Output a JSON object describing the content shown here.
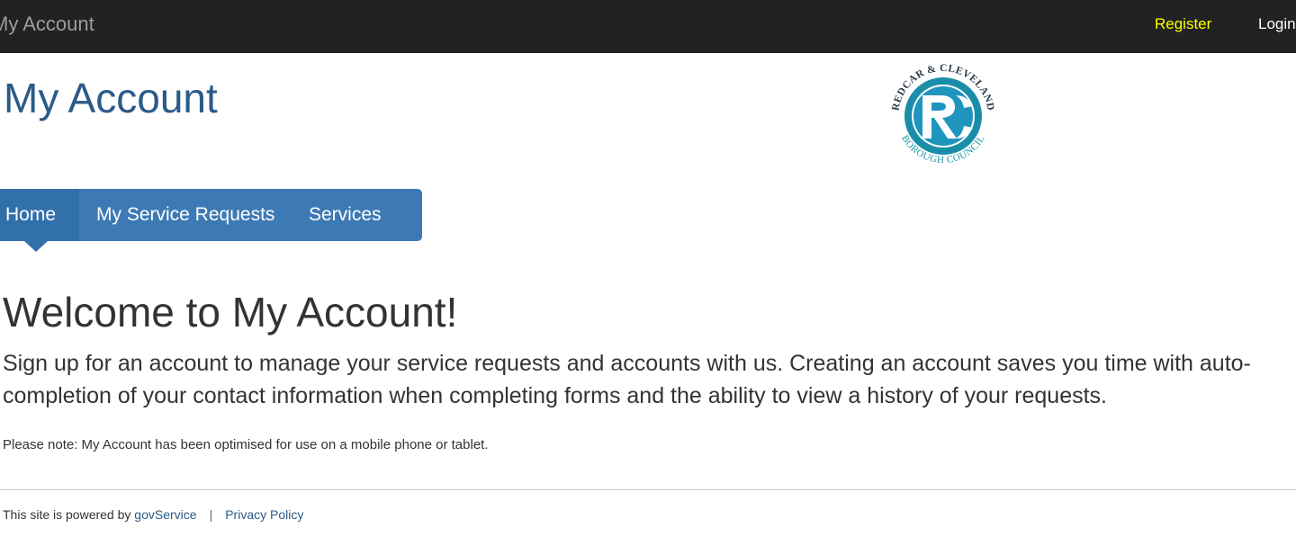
{
  "topbar": {
    "brand": "My Account",
    "register": "Register",
    "login": "Login"
  },
  "header": {
    "title": "My Account",
    "logo": {
      "arc_top_text": "REDCAR & CLEVELAND",
      "arc_bottom_text": "BOROUGH COUNCIL",
      "monogram": "RC",
      "colors": {
        "ring": "#1a8ea8",
        "inner": "#2a9cc0",
        "text": "#2b3a4a",
        "accent": "#1a9aa8"
      }
    }
  },
  "tabs": [
    {
      "label": "Home",
      "active": true
    },
    {
      "label": "My Service Requests",
      "active": false
    },
    {
      "label": "Services",
      "active": false
    }
  ],
  "main": {
    "heading": "Welcome to My Account!",
    "lead": "Sign up for an account to manage your service requests and accounts with us. Creating an account saves you time with auto-completion of your contact information when completing forms and the ability to view a history of your requests.",
    "note": "Please note: My Account has been optimised for use on a mobile phone or tablet."
  },
  "footer": {
    "powered_prefix": "This site is powered by ",
    "powered_link": "govService",
    "separator": "|",
    "privacy": "Privacy Policy"
  },
  "colors": {
    "navbar_bg": "#222222",
    "register": "#ffff00",
    "tabs_bg": "#3d7ab5",
    "title": "#2b5a88"
  }
}
